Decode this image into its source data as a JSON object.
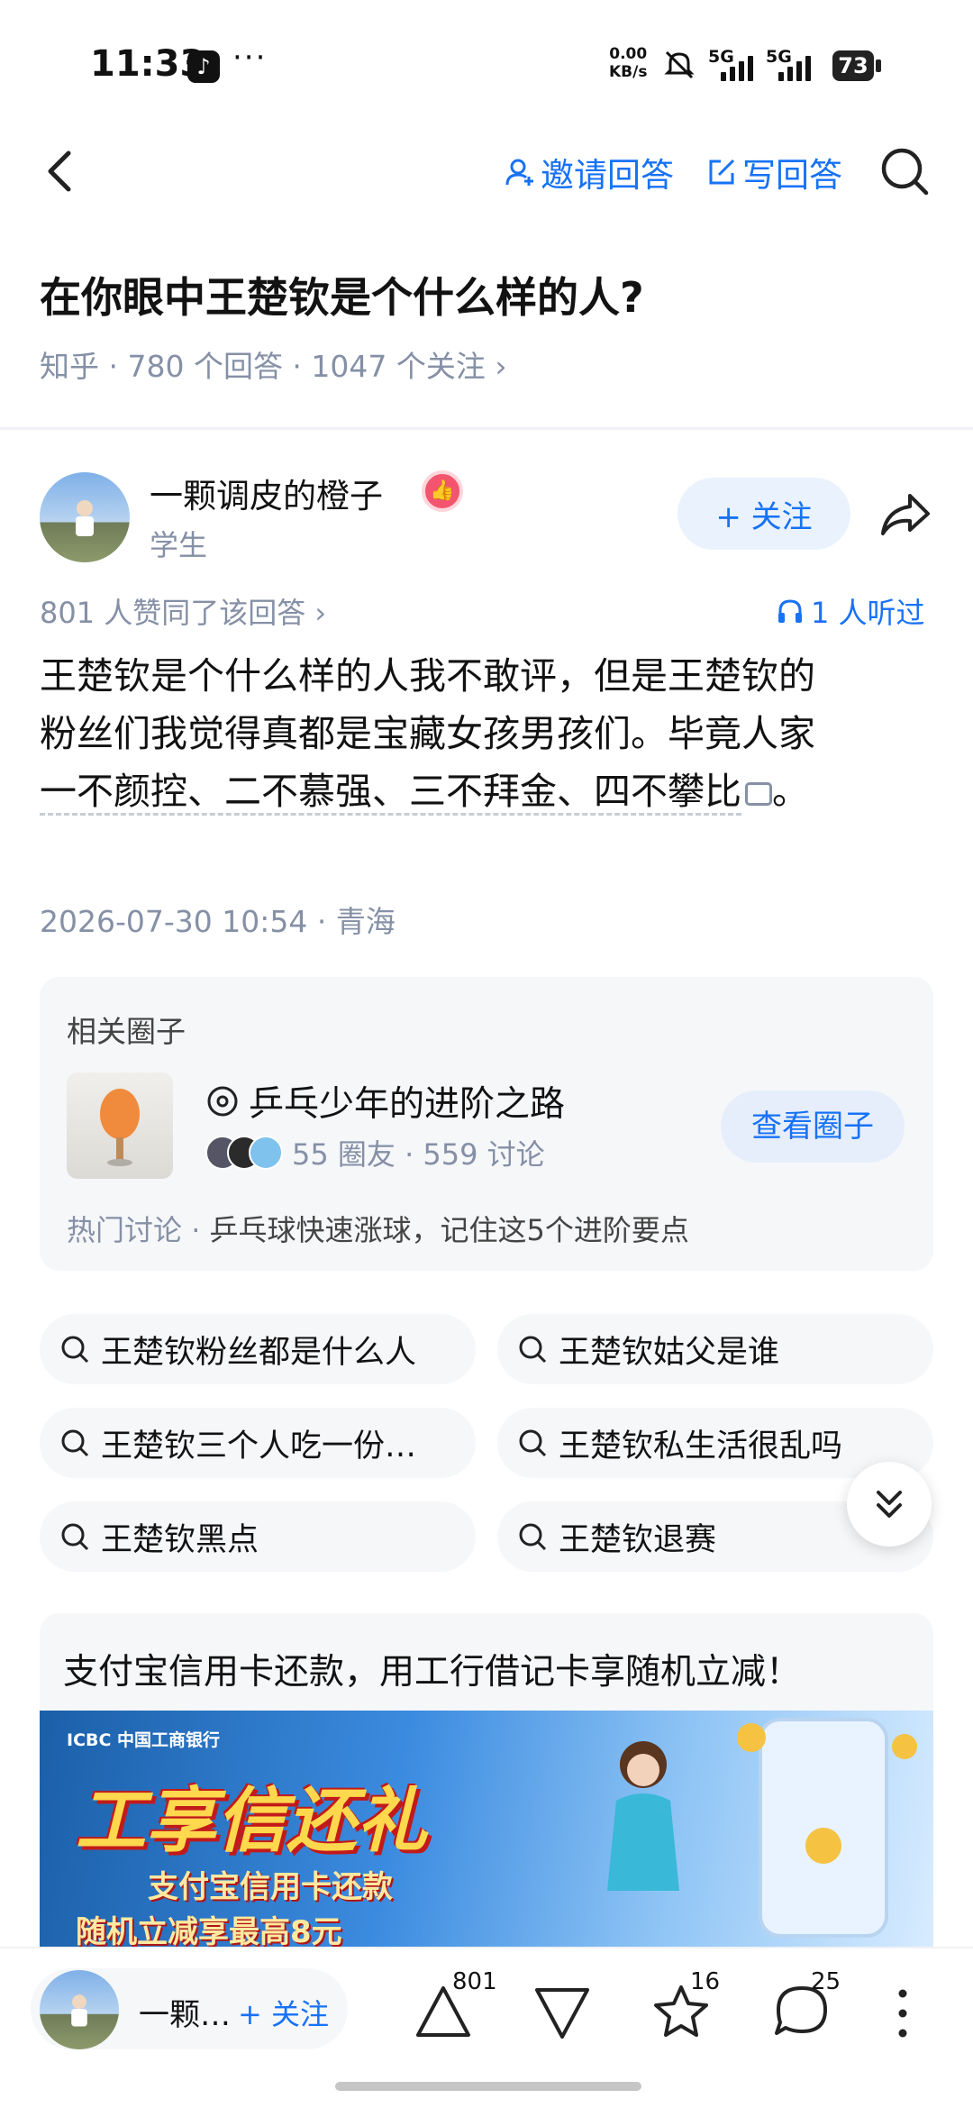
{
  "status_bar": {
    "time": "11:33",
    "more": "···",
    "net_speed_value": "0.00",
    "net_speed_unit": "KB/s",
    "sim1": "5G",
    "sim2": "5G",
    "battery": "73"
  },
  "header": {
    "invite_label": "邀请回答",
    "write_label": "写回答"
  },
  "question": {
    "title": "在你眼中王楚钦是个什么样的人?",
    "meta": "知乎 · 780 个回答 · 1047 个关注 ›"
  },
  "author": {
    "name": "一颗调皮的橙子",
    "subtitle": "学生",
    "follow_label": "+ 关注"
  },
  "answer": {
    "agree_text": "801 人赞同了该回答 ›",
    "listened_text": "1 人听过",
    "lines": [
      "王楚钦是个什么样的人我不敢评，但是王楚钦的",
      "粉丝们我觉得真都是宝藏女孩男孩们。毕竟人家",
      "一不颜控、二不慕强、三不拜金、四不攀比"
    ],
    "end_punct": "。",
    "date_location": "2026-07-30 10:54 · 青海"
  },
  "circle_card": {
    "label": "相关圈子",
    "name": "乒乓少年的进阶之路",
    "stats": "55 圈友 · 559 讨论",
    "button": "查看圈子",
    "hot_label": "热门讨论",
    "hot_sep": " · ",
    "hot_text": "乒乓球快速涨球，记住这5个进阶要点"
  },
  "search_chips": [
    "王楚钦粉丝都是什么人",
    "王楚钦姑父是谁",
    "王楚钦三个人吃一份…",
    "王楚钦私生活很乱吗",
    "王楚钦黑点",
    "王楚钦退赛"
  ],
  "ad": {
    "title": "支付宝信用卡还款，用工行借记卡享随机立减！",
    "logo_text": "ICBC 中国工商银行",
    "big_text": "工享信还礼",
    "sub_text": "支付宝信用卡还款",
    "sub_text2": "随机立减享最高8元"
  },
  "bottom_bar": {
    "author_short": "一颗…",
    "follow_label": "+ 关注",
    "upvote_count": "801",
    "favorite_count": "16",
    "comment_count": "25"
  },
  "colors": {
    "accent": "#1772f6",
    "muted": "#8590a6",
    "card_bg": "#f6f7f9"
  }
}
